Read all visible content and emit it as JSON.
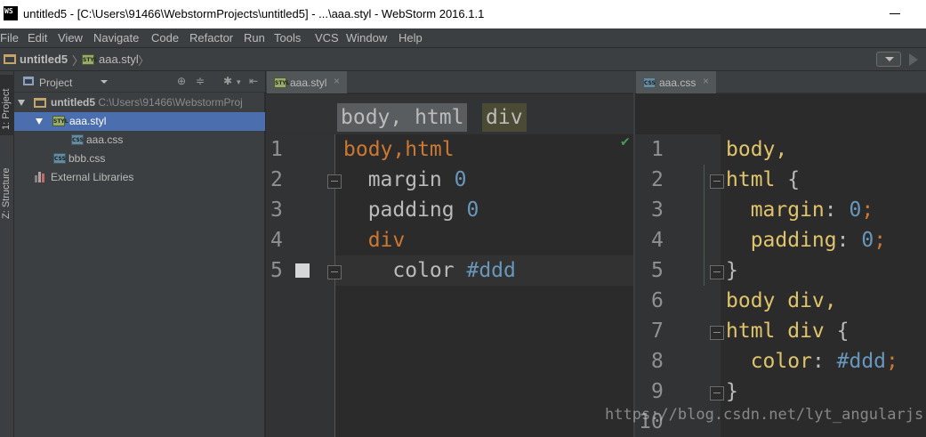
{
  "window": {
    "title": "untitled5 - [C:\\Users\\91466\\WebstormProjects\\untitled5] - ...\\aaa.styl - WebStorm 2016.1.1",
    "logo_text": "WS"
  },
  "menu": [
    "File",
    "Edit",
    "View",
    "Navigate",
    "Code",
    "Refactor",
    "Run",
    "Tools",
    "VCS",
    "Window",
    "Help"
  ],
  "navbar": {
    "crumbs": [
      "untitled5",
      "aaa.styl"
    ]
  },
  "tool_stripe": {
    "project_label": "1: Project",
    "structure_label": "Z: Structure"
  },
  "project_panel": {
    "header": "Project",
    "tree": [
      {
        "label": "untitled5",
        "path": "C:\\Users\\91466\\WebstormProj",
        "type": "folder",
        "expanded": true
      },
      {
        "label": "aaa.styl",
        "type": "styl",
        "expanded": true,
        "selected": true
      },
      {
        "label": "aaa.css",
        "type": "css"
      },
      {
        "label": "bbb.css",
        "type": "css"
      },
      {
        "label": "External Libraries",
        "type": "library"
      }
    ]
  },
  "editor_left": {
    "tab": "aaa.styl",
    "breadcrumbs": [
      "body, html",
      "div"
    ],
    "line_numbers": [
      "1",
      "2",
      "3",
      "4",
      "5"
    ],
    "lines": [
      {
        "tokens": [
          {
            "t": "body,html",
            "c": "kw-orange"
          }
        ]
      },
      {
        "tokens": [
          {
            "t": "  margin ",
            "c": "txt"
          },
          {
            "t": "0",
            "c": "num"
          }
        ]
      },
      {
        "tokens": [
          {
            "t": "  padding ",
            "c": "txt"
          },
          {
            "t": "0",
            "c": "num"
          }
        ]
      },
      {
        "tokens": [
          {
            "t": "  div",
            "c": "kw-orange"
          }
        ]
      },
      {
        "tokens": [
          {
            "t": "    color ",
            "c": "txt"
          },
          {
            "t": "#ddd",
            "c": "num"
          }
        ]
      }
    ]
  },
  "editor_right": {
    "tab": "aaa.css",
    "line_numbers": [
      "1",
      "2",
      "3",
      "4",
      "5",
      "6",
      "7",
      "8",
      "9",
      "10"
    ],
    "lines": [
      {
        "tokens": [
          {
            "t": "body,",
            "c": "sel-yellow"
          }
        ]
      },
      {
        "tokens": [
          {
            "t": "html ",
            "c": "sel-yellow"
          },
          {
            "t": "{",
            "c": "txt"
          }
        ]
      },
      {
        "tokens": [
          {
            "t": "  margin",
            "c": "sel-yellow"
          },
          {
            "t": ": ",
            "c": "txt"
          },
          {
            "t": "0",
            "c": "num"
          },
          {
            "t": ";",
            "c": "kw-orange"
          }
        ]
      },
      {
        "tokens": [
          {
            "t": "  padding",
            "c": "sel-yellow"
          },
          {
            "t": ": ",
            "c": "txt"
          },
          {
            "t": "0",
            "c": "num"
          },
          {
            "t": ";",
            "c": "kw-orange"
          }
        ]
      },
      {
        "tokens": [
          {
            "t": "}",
            "c": "txt"
          }
        ]
      },
      {
        "tokens": [
          {
            "t": "body div,",
            "c": "sel-yellow"
          }
        ]
      },
      {
        "tokens": [
          {
            "t": "html div ",
            "c": "sel-yellow"
          },
          {
            "t": "{",
            "c": "txt"
          }
        ]
      },
      {
        "tokens": [
          {
            "t": "  color",
            "c": "sel-yellow"
          },
          {
            "t": ": ",
            "c": "txt"
          },
          {
            "t": "#ddd",
            "c": "num"
          },
          {
            "t": ";",
            "c": "kw-orange"
          }
        ]
      },
      {
        "tokens": [
          {
            "t": "}",
            "c": "txt"
          }
        ]
      },
      {
        "tokens": []
      }
    ]
  },
  "watermark": "https://blog.csdn.net/lyt_angularjs",
  "colors": {
    "keyword": "#cc7832",
    "number": "#6897bb",
    "selector": "#e0c46c",
    "selection": "#4b6eaf"
  }
}
